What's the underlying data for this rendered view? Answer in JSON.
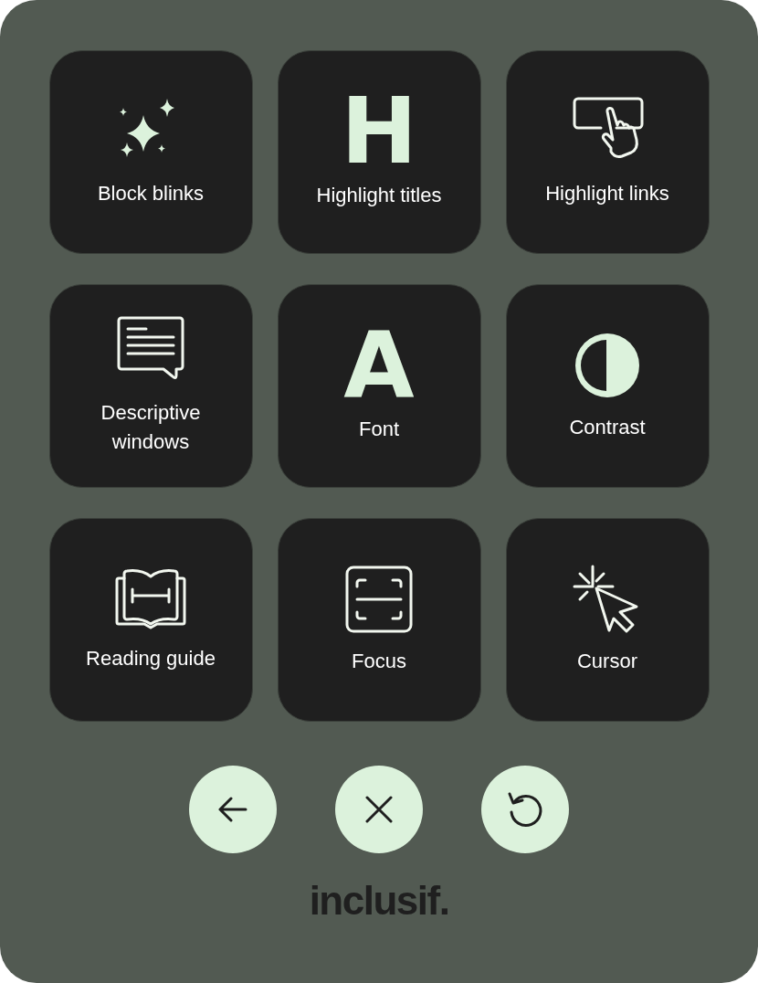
{
  "tiles": [
    {
      "label": "Block blinks"
    },
    {
      "label": "Highlight titles",
      "glyph": "H"
    },
    {
      "label": "Highlight links"
    },
    {
      "label": "Descriptive windows"
    },
    {
      "label": "Font",
      "glyph": "A"
    },
    {
      "label": "Contrast"
    },
    {
      "label": "Reading guide"
    },
    {
      "label": "Focus"
    },
    {
      "label": "Cursor"
    }
  ],
  "logo": "inclusif."
}
